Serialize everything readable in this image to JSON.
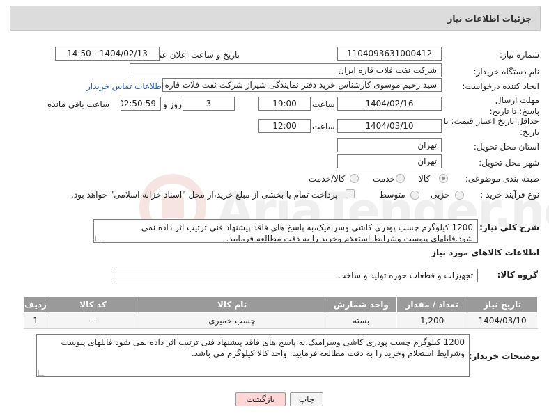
{
  "header": {
    "title": "جزئیات اطلاعات نیاز"
  },
  "watermark": {
    "text": "AriaTender.net"
  },
  "fields": {
    "need_number_label": "شماره نیاز:",
    "need_number": "1104093631000412",
    "announce_label": "تاریخ و ساعت اعلان عمومی:",
    "announce_value": "1404/02/13 - 14:50",
    "buyer_org_label": "نام دستگاه خریدار:",
    "buyer_org": "شرکت نفت فلات قاره ایران",
    "requester_label": "ایجاد کننده درخواست:",
    "requester": "سید رحیم موسوی کارشناس خرید دفتر نمایندگی شیراز شرکت نفت فلات قاره ا",
    "contact_link": "اطلاعات تماس خریدار",
    "deadline_label": "مهلت ارسال پاسخ: تا تاریخ:",
    "deadline_date": "1404/02/16",
    "time_label": "ساعت",
    "deadline_time": "19:00",
    "days_value": "3",
    "days_label": "روز و",
    "remaining_value": "02:50:59",
    "remaining_label": "ساعت باقی مانده",
    "min_price_label": "حداقل تاریخ اعتبار قیمت: تا تاریخ:",
    "price_date": "1404/03/10",
    "price_time": "12:00",
    "province_label": "استان محل تحویل:",
    "province": "تهران",
    "city_label": "شهر محل تحویل:",
    "city": "تهران",
    "category_label": "طبقه بندی موضوعی:",
    "category_options": [
      "کالا",
      "خدمت",
      "کالا/خدمت"
    ],
    "process_label": "نوع فرآیند خرید :",
    "process_options": [
      "جزیی",
      "متوسط"
    ],
    "payment_note": "پرداخت تمام یا بخشی از مبلغ خرید،از محل \"اسناد خزانه اسلامی\" خواهد بود.",
    "description_label": "شرح کلی نیاز:",
    "description": "1200 کیلوگرم چسب پودری کاشی وسرامیک،به پاسخ های فاقد پیشنهاد فنی ترتیب اثر داده نمی شود.فایلهای پیوست وشرایط استعلام وخرید را به دقت مطالعه فرمایید.",
    "goods_info_title": "اطلاعات کالاهای مورد نیاز",
    "goods_group_label": "گروه کالا:",
    "goods_group": "تجهیزات و قطعات حوزه تولید و ساخت",
    "buyer_notes_label": "توضیحات خریدار:",
    "buyer_notes": "1200 کیلوگرم چسب پودری کاشی وسرامیک،به پاسخ های فاقد پیشنهاد فنی ترتیب اثر داده نمی شود.فایلهای پیوست وشرایط استعلام وخرید را به دقت مطالعه فرمایید. واحد کالا کیلوگرم می باشد."
  },
  "table": {
    "headers": [
      "ردیف",
      "کد کالا",
      "نام کالا",
      "واحد شمارش",
      "تعداد / مقدار",
      "تاریخ نیاز"
    ],
    "rows": [
      [
        "1",
        "--",
        "چسب خمیری",
        "بسته",
        "1,200",
        "1404/03/10"
      ]
    ]
  },
  "buttons": {
    "print": "چاپ",
    "back": "بازگشت"
  }
}
